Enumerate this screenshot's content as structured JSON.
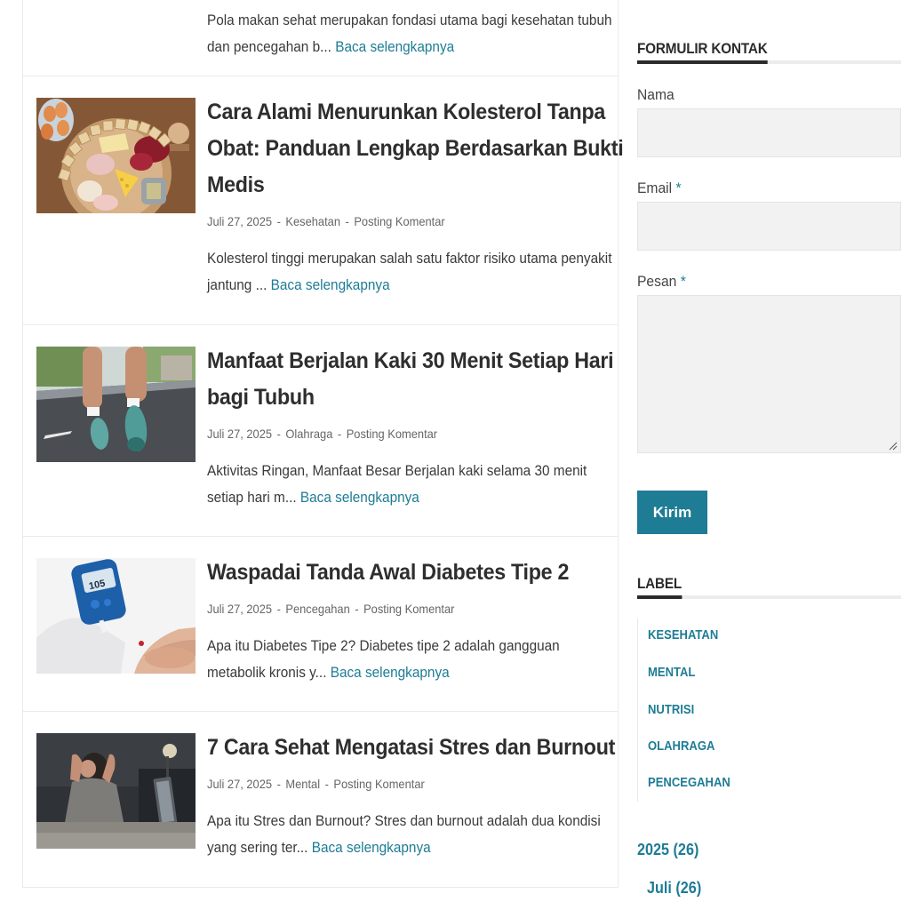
{
  "posts": [
    {
      "title": "",
      "date": "",
      "category": "",
      "comment": "",
      "excerpt_lines": [
        "Pola makan sehat merupakan fondasi utama bagi kesehatan tubuh",
        "dan pencegahan b... "
      ],
      "read_more": "Baca selengkapnya"
    },
    {
      "title_lines": [
        "Cara Alami Menurunkan Kolesterol Tanpa",
        "Obat: Panduan Lengkap Berdasarkan Bukti",
        "Medis"
      ],
      "date": "Juli 27, 2025",
      "category": "Kesehatan",
      "comment": "Posting Komentar",
      "excerpt_lines": [
        "Kolesterol tinggi merupakan salah satu faktor risiko utama penyakit",
        "jantung ... "
      ],
      "read_more": "Baca selengkapnya"
    },
    {
      "title_lines": [
        "Manfaat Berjalan Kaki 30 Menit Setiap Hari",
        "bagi Tubuh"
      ],
      "date": "Juli 27, 2025",
      "category": "Olahraga",
      "comment": "Posting Komentar",
      "excerpt_lines": [
        "Aktivitas Ringan, Manfaat Besar Berjalan kaki selama 30 menit",
        "setiap hari m... "
      ],
      "read_more": "Baca selengkapnya"
    },
    {
      "title_lines": [
        "Waspadai Tanda Awal Diabetes Tipe 2"
      ],
      "date": "Juli 27, 2025",
      "category": "Pencegahan",
      "comment": "Posting Komentar",
      "excerpt_lines": [
        "Apa itu Diabetes Tipe 2? Diabetes tipe 2 adalah gangguan",
        "metabolik kronis y... "
      ],
      "read_more": "Baca selengkapnya"
    },
    {
      "title_lines": [
        "7 Cara Sehat Mengatasi Stres dan Burnout"
      ],
      "date": "Juli 27, 2025",
      "category": "Mental",
      "comment": "Posting Komentar",
      "excerpt_lines": [
        "Apa itu Stres dan Burnout? Stres dan burnout adalah dua kondisi",
        "yang sering ter... "
      ],
      "read_more": "Baca selengkapnya"
    }
  ],
  "meta_separator": "-",
  "thumb_text": {
    "cholesterol_tiles": "CHOLESTEROL",
    "glucometer_reading": "105"
  },
  "contact_form": {
    "title": "FORMULIR KONTAK",
    "name_label": "Nama",
    "email_label": "Email",
    "message_label": "Pesan",
    "required_mark": "*",
    "name_value": "",
    "email_value": "",
    "message_value": "",
    "submit_label": "Kirim"
  },
  "labels_widget": {
    "title": "LABEL",
    "items": [
      "Kesehatan",
      "Mental",
      "Nutrisi",
      "Olahraga",
      "Pencegahan"
    ]
  },
  "archive": {
    "year": "2025 (26)",
    "month": "Juli (26)"
  },
  "colors": {
    "accent": "#1e7c95",
    "heading": "#2e2e2e",
    "field_bg": "#f2f2f2"
  },
  "icons": {
    "textarea_resize": "resize-grip-icon"
  }
}
